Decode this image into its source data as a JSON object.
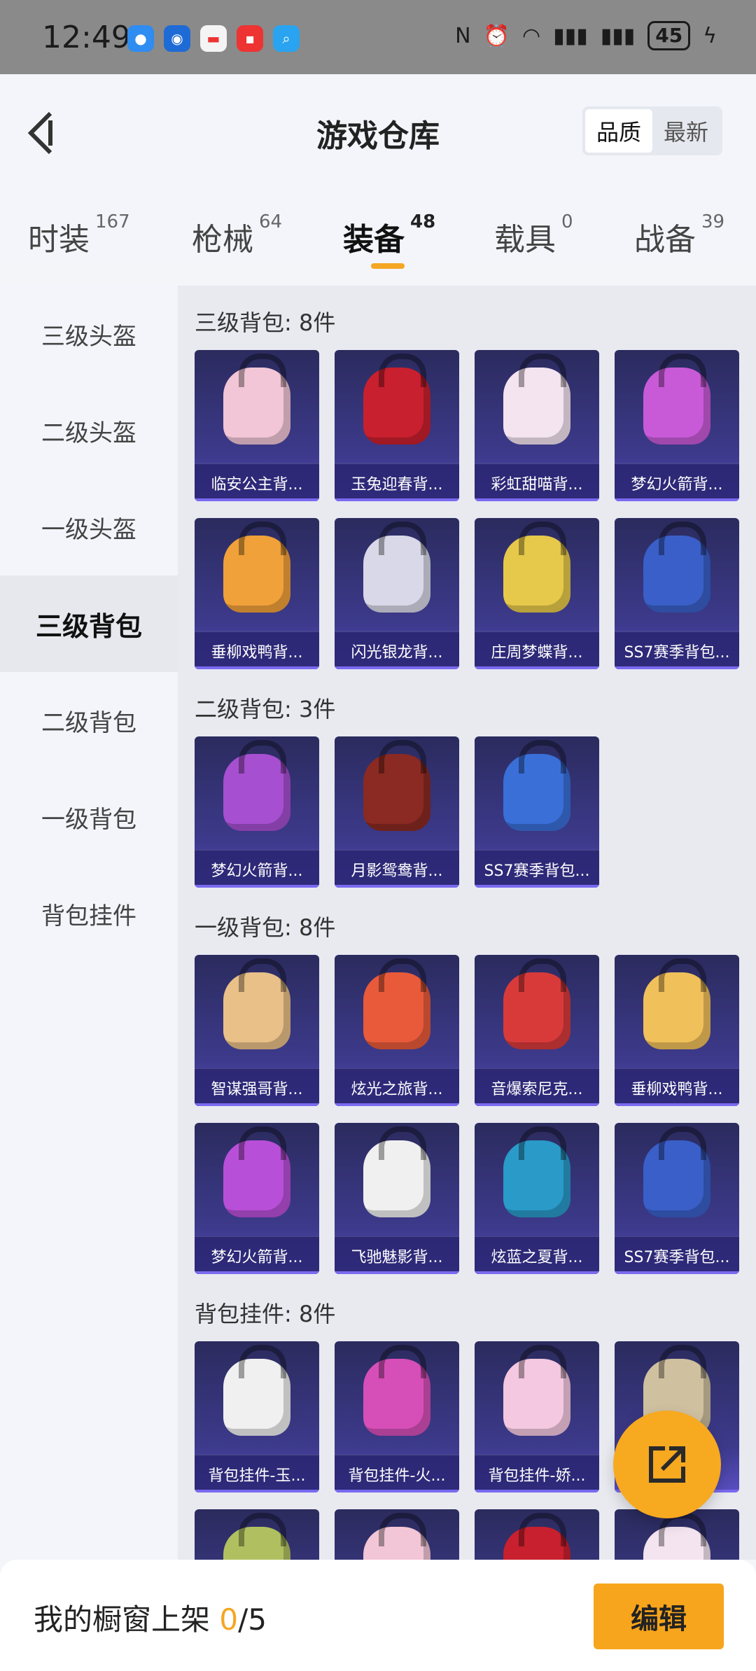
{
  "status_bar": {
    "time": "12:49",
    "battery": "45"
  },
  "header": {
    "title": "游戏仓库",
    "sort_options": [
      "品质",
      "最新"
    ],
    "active_sort": "品质"
  },
  "tabs": [
    {
      "label": "时装",
      "count": "167"
    },
    {
      "label": "枪械",
      "count": "64"
    },
    {
      "label": "装备",
      "count": "48"
    },
    {
      "label": "载具",
      "count": "0"
    },
    {
      "label": "战备",
      "count": "39"
    }
  ],
  "active_tab": "装备",
  "sidebar": {
    "items": [
      "三级头盔",
      "二级头盔",
      "一级头盔",
      "三级背包",
      "二级背包",
      "一级背包",
      "背包挂件"
    ],
    "active": "三级背包"
  },
  "sections": [
    {
      "title": "三级背包: 8件",
      "items": [
        "临安公主背...",
        "玉兔迎春背...",
        "彩虹甜喵背...",
        "梦幻火箭背...",
        "垂柳戏鸭背...",
        "闪光银龙背...",
        "庄周梦蝶背...",
        "SS7赛季背包..."
      ]
    },
    {
      "title": "二级背包: 3件",
      "items": [
        "梦幻火箭背...",
        "月影鸳鸯背...",
        "SS7赛季背包..."
      ]
    },
    {
      "title": "一级背包: 8件",
      "items": [
        "智谋强哥背...",
        "炫光之旅背...",
        "音爆索尼克...",
        "垂柳戏鸭背...",
        "梦幻火箭背...",
        "飞驰魅影背...",
        "炫蓝之夏背...",
        "SS7赛季背包..."
      ]
    },
    {
      "title": "背包挂件: 8件",
      "items": [
        "背包挂件-玉...",
        "背包挂件-火...",
        "背包挂件-娇..."
      ]
    }
  ],
  "bottom_bar": {
    "showcase_label": "我的橱窗上架",
    "showcase_count": "0",
    "showcase_total": "/5",
    "edit_label": "编辑"
  },
  "colors": {
    "accent": "#f5a623",
    "card_bg": "#3d3a8c"
  },
  "icons": [
    "back-arrow-icon",
    "share-icon"
  ]
}
